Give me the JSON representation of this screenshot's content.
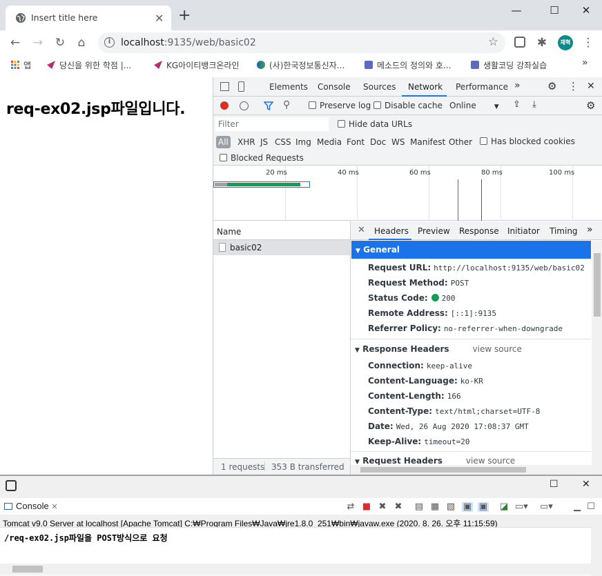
{
  "browser": {
    "tab_title": "Insert title here",
    "new_tab": "+",
    "url_host": "localhost",
    "url_rest": ":9135/web/basic02",
    "avatar": "재혁",
    "window_controls": [
      "—",
      "☐",
      "✕"
    ]
  },
  "bookmarks": [
    {
      "label": "앱",
      "icon": "apps-grid-icon"
    },
    {
      "label": "당신을 위한 학점 |...",
      "icon": "bookmark-icon"
    },
    {
      "label": "KG아이티뱅크온라인",
      "icon": "bookmark-icon"
    },
    {
      "label": "(사)한국정보통신자...",
      "icon": "bookmark-icon"
    },
    {
      "label": "메소드의 정의와 호...",
      "icon": "bookmark-icon"
    },
    {
      "label": "생활코딩 강좌실습",
      "icon": "bookmark-icon"
    }
  ],
  "page": {
    "heading": "req-ex02.jsp파일입니다."
  },
  "devtools": {
    "tabs": [
      "Elements",
      "Console",
      "Sources",
      "Network",
      "Performance"
    ],
    "active_tab": "Network",
    "preserve_log": "Preserve log",
    "disable_cache": "Disable cache",
    "throttle": "Online",
    "filter_placeholder": "Filter",
    "hide_data_urls": "Hide data URLs",
    "types": [
      "All",
      "XHR",
      "JS",
      "CSS",
      "Img",
      "Media",
      "Font",
      "Doc",
      "WS",
      "Manifest",
      "Other"
    ],
    "has_blocked_cookies": "Has blocked cookies",
    "blocked_requests": "Blocked Requests",
    "ticks": [
      "20 ms",
      "40 ms",
      "60 ms",
      "80 ms",
      "100 ms"
    ],
    "name_header": "Name",
    "requests": [
      "basic02"
    ],
    "status_requests": "1 requests",
    "status_transferred": "353 B transferred",
    "detail_tabs": [
      "Headers",
      "Preview",
      "Response",
      "Initiator",
      "Timing"
    ],
    "active_detail_tab": "Headers",
    "general_title": "General",
    "general": [
      {
        "key": "Request URL:",
        "value": "http://localhost:9135/web/basic02"
      },
      {
        "key": "Request Method:",
        "value": "POST"
      },
      {
        "key": "Status Code:",
        "value": "200"
      },
      {
        "key": "Remote Address:",
        "value": "[::1]:9135"
      },
      {
        "key": "Referrer Policy:",
        "value": "no-referrer-when-downgrade"
      }
    ],
    "response_headers_title": "Response Headers",
    "view_source": "view source",
    "response_headers": [
      {
        "key": "Connection:",
        "value": "keep-alive"
      },
      {
        "key": "Content-Language:",
        "value": "ko-KR"
      },
      {
        "key": "Content-Length:",
        "value": "166"
      },
      {
        "key": "Content-Type:",
        "value": "text/html;charset=UTF-8"
      },
      {
        "key": "Date:",
        "value": "Wed, 26 Aug 2020 17:08:37 GMT"
      },
      {
        "key": "Keep-Alive:",
        "value": "timeout=20"
      }
    ],
    "request_headers_title": "Request Headers"
  },
  "eclipse": {
    "console_tab": "Console",
    "server_info": "Tomcat v9.0 Server at localhost [Apache Tomcat] C:₩Program Files₩Java₩jre1.8.0_251₩bin₩javaw.exe (2020. 8. 26. 오후 11:15:59)",
    "output_path": "/req-ex02.jsp",
    "output_text": "파일을 POST방식으로 요청"
  },
  "colors": {
    "accent": "#1a73e8",
    "record_red": "#d93025",
    "status_green": "#0f9d58"
  }
}
